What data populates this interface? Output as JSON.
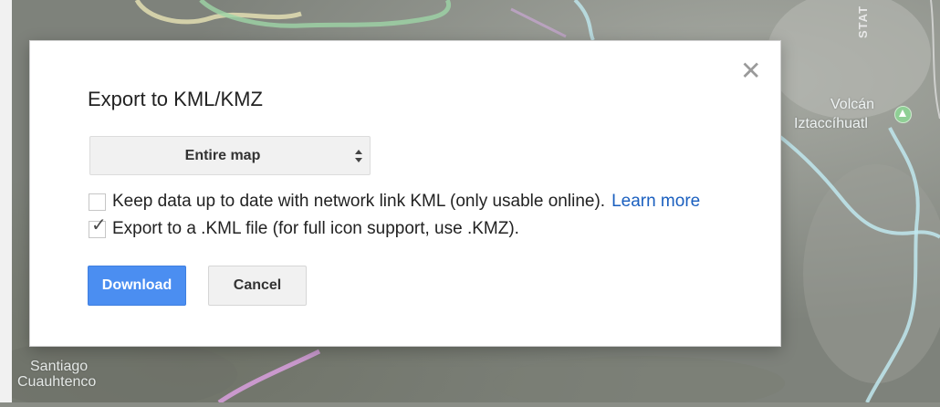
{
  "map": {
    "labels": {
      "volcano_line1": "Volcán",
      "volcano_line2": "Iztaccíhuatl",
      "town_line1": "Santiago",
      "town_line2": "Cuauhtenco",
      "road": "STAT"
    }
  },
  "dialog": {
    "title": "Export to KML/KMZ",
    "close_glyph": "✕",
    "scope_select": {
      "selected": "Entire map"
    },
    "options": {
      "network_link": {
        "label": "Keep data up to date with network link KML (only usable online).",
        "link_text": "Learn more",
        "checked": false
      },
      "kml_file": {
        "label": "Export to a .KML file (for full icon support, use .KMZ).",
        "checked": true,
        "check_glyph": "✓"
      }
    },
    "buttons": {
      "download": "Download",
      "cancel": "Cancel"
    }
  },
  "colors": {
    "primary_button": "#4b8ef1",
    "link": "#1a5fbf"
  }
}
